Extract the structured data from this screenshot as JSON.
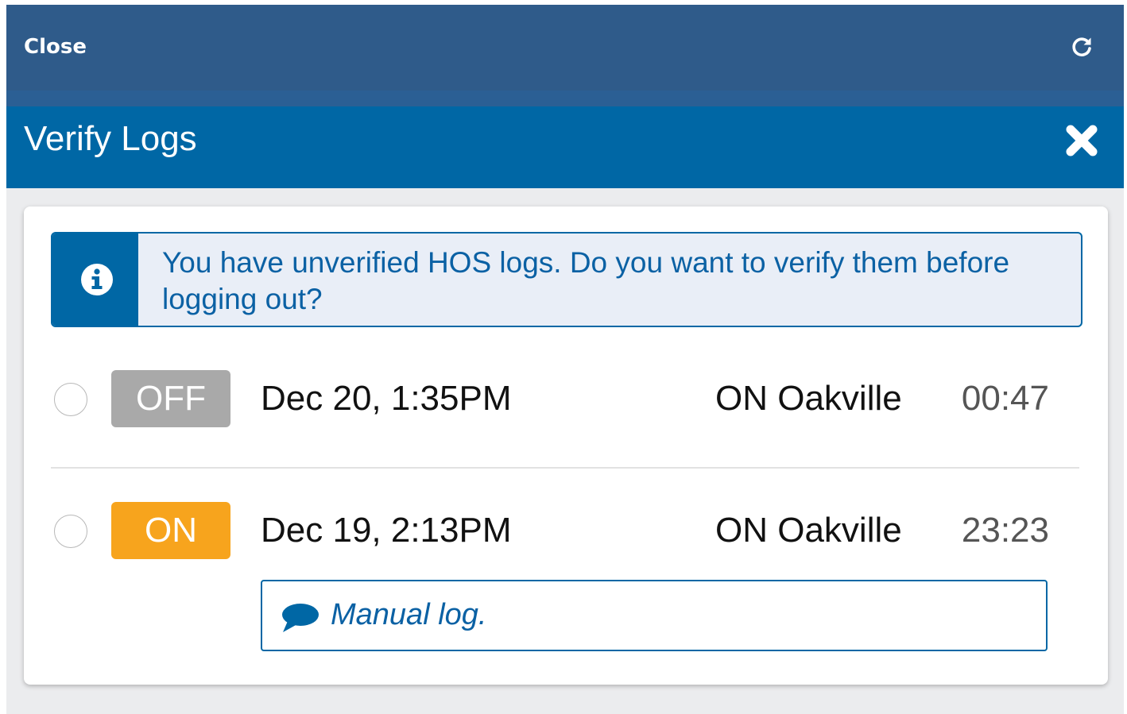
{
  "topbar": {
    "close_label": "Close",
    "refresh_icon": "refresh-icon"
  },
  "dialog": {
    "title": "Verify Logs",
    "close_icon": "close-x-icon"
  },
  "alert": {
    "icon": "info-icon",
    "message": "You have unverified HOS logs. Do you want to verify them before logging out?"
  },
  "logs": [
    {
      "status": "OFF",
      "date": "Dec 20, 1:35PM",
      "location": "ON Oakville",
      "duration": "00:47",
      "selected": false
    },
    {
      "status": "ON",
      "date": "Dec 19, 2:13PM",
      "location": "ON Oakville",
      "duration": "23:23",
      "selected": false,
      "note_icon": "comment-icon",
      "note": "Manual log."
    }
  ],
  "colors": {
    "topbar": "#2f5b8a",
    "titlebar": "#0067a5",
    "alert_bg": "#e9eef7",
    "off_badge": "#a9a9a9",
    "on_badge": "#f7a41d",
    "accent_text": "#0b61a4"
  }
}
